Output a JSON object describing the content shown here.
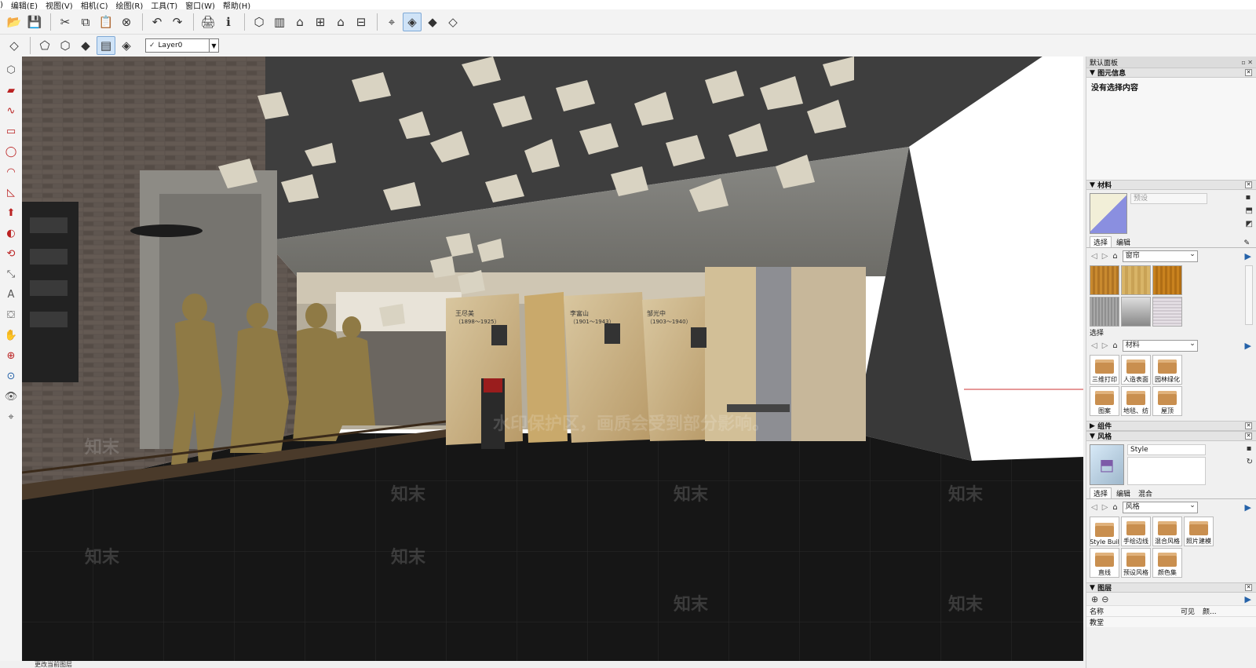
{
  "menu": [
    "编辑(E)",
    "视图(V)",
    "相机(C)",
    "绘图(R)",
    "工具(T)",
    "窗口(W)",
    "帮助(H)"
  ],
  "toolbar": {
    "layer_select": "Layer0"
  },
  "status_text": "更改当前图层",
  "viewport": {
    "watermark_main": "水印保护区，画质会受到部分影响。",
    "watermark_brand": "知末",
    "panels": [
      {
        "name": "王尽美",
        "years": "（1898～1925）"
      },
      {
        "name": "李富山",
        "years": "（1901～1943）"
      },
      {
        "name": "邹光中",
        "years": "（1903～1940）"
      }
    ],
    "vertical_names": [
      "王尽美",
      "李富山",
      "邹光中"
    ]
  },
  "right_panel": {
    "tray_title": "默认面板",
    "entity_info": {
      "header": "图元信息",
      "text": "没有选择内容"
    },
    "materials": {
      "header": "材料",
      "name_placeholder": "预设",
      "tabs": [
        "选择",
        "编辑"
      ],
      "dropdown": "窗帘",
      "select_label": "选择",
      "dropdown2": "材料",
      "items": [
        "三维打印",
        "人造表面",
        "园林绿化",
        "图案",
        "地毯、纺",
        "屋顶"
      ]
    },
    "components": {
      "header": "组件"
    },
    "styles": {
      "header": "风格",
      "style_name": "Style",
      "tabs": [
        "选择",
        "编辑",
        "混合"
      ],
      "dropdown": "风格",
      "items": [
        "Style Buil",
        "手绘边线",
        "混合风格",
        "照片建模",
        "直线",
        "预设风格",
        "颜色集"
      ]
    },
    "layers": {
      "header": "图层",
      "columns": [
        "名称",
        "可见",
        "颜..."
      ],
      "first_row": "教堂"
    }
  },
  "colors": {
    "ceiling": "#3e3e3e",
    "floor": "#161616",
    "brick": "#5b524c",
    "paper": "#d9d3c2",
    "accent_blue": "#2562a9"
  }
}
